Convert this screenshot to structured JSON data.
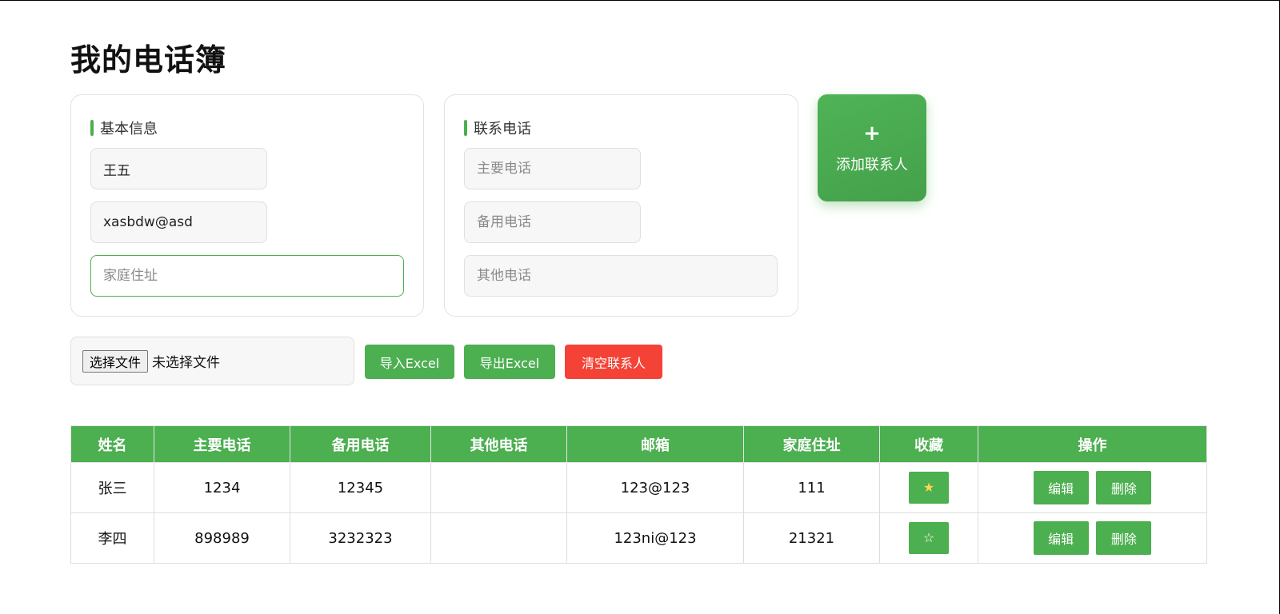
{
  "page": {
    "title": "我的电话簿"
  },
  "basic_info": {
    "heading": "基本信息",
    "name": {
      "value": "王五",
      "placeholder": ""
    },
    "email": {
      "value": "xasbdw@asd",
      "placeholder": ""
    },
    "address": {
      "value": "",
      "placeholder": "家庭住址"
    }
  },
  "phones": {
    "heading": "联系电话",
    "primary": {
      "value": "",
      "placeholder": "主要电话"
    },
    "backup": {
      "value": "",
      "placeholder": "备用电话"
    },
    "other": {
      "value": "",
      "placeholder": "其他电话"
    }
  },
  "add_button": {
    "icon": "+",
    "label": "添加联系人"
  },
  "file_input": {
    "button_label": "选择文件",
    "status": "未选择文件"
  },
  "actions": {
    "import_label": "导入Excel",
    "export_label": "导出Excel",
    "clear_label": "清空联系人"
  },
  "colors": {
    "accent": "#4caf50",
    "danger": "#f44336",
    "star_on": "#ffd54f"
  },
  "table": {
    "headers": [
      "姓名",
      "主要电话",
      "备用电话",
      "其他电话",
      "邮箱",
      "家庭住址",
      "收藏",
      "操作"
    ],
    "rows": [
      {
        "name": "张三",
        "primary": "1234",
        "backup": "12345",
        "other": "",
        "email": "123@123",
        "address": "111",
        "favorite": "★",
        "edit": "编辑",
        "delete": "删除"
      },
      {
        "name": "李四",
        "primary": "898989",
        "backup": "3232323",
        "other": "",
        "email": "123ni@123",
        "address": "21321",
        "favorite": "☆",
        "edit": "编辑",
        "delete": "删除"
      }
    ]
  }
}
